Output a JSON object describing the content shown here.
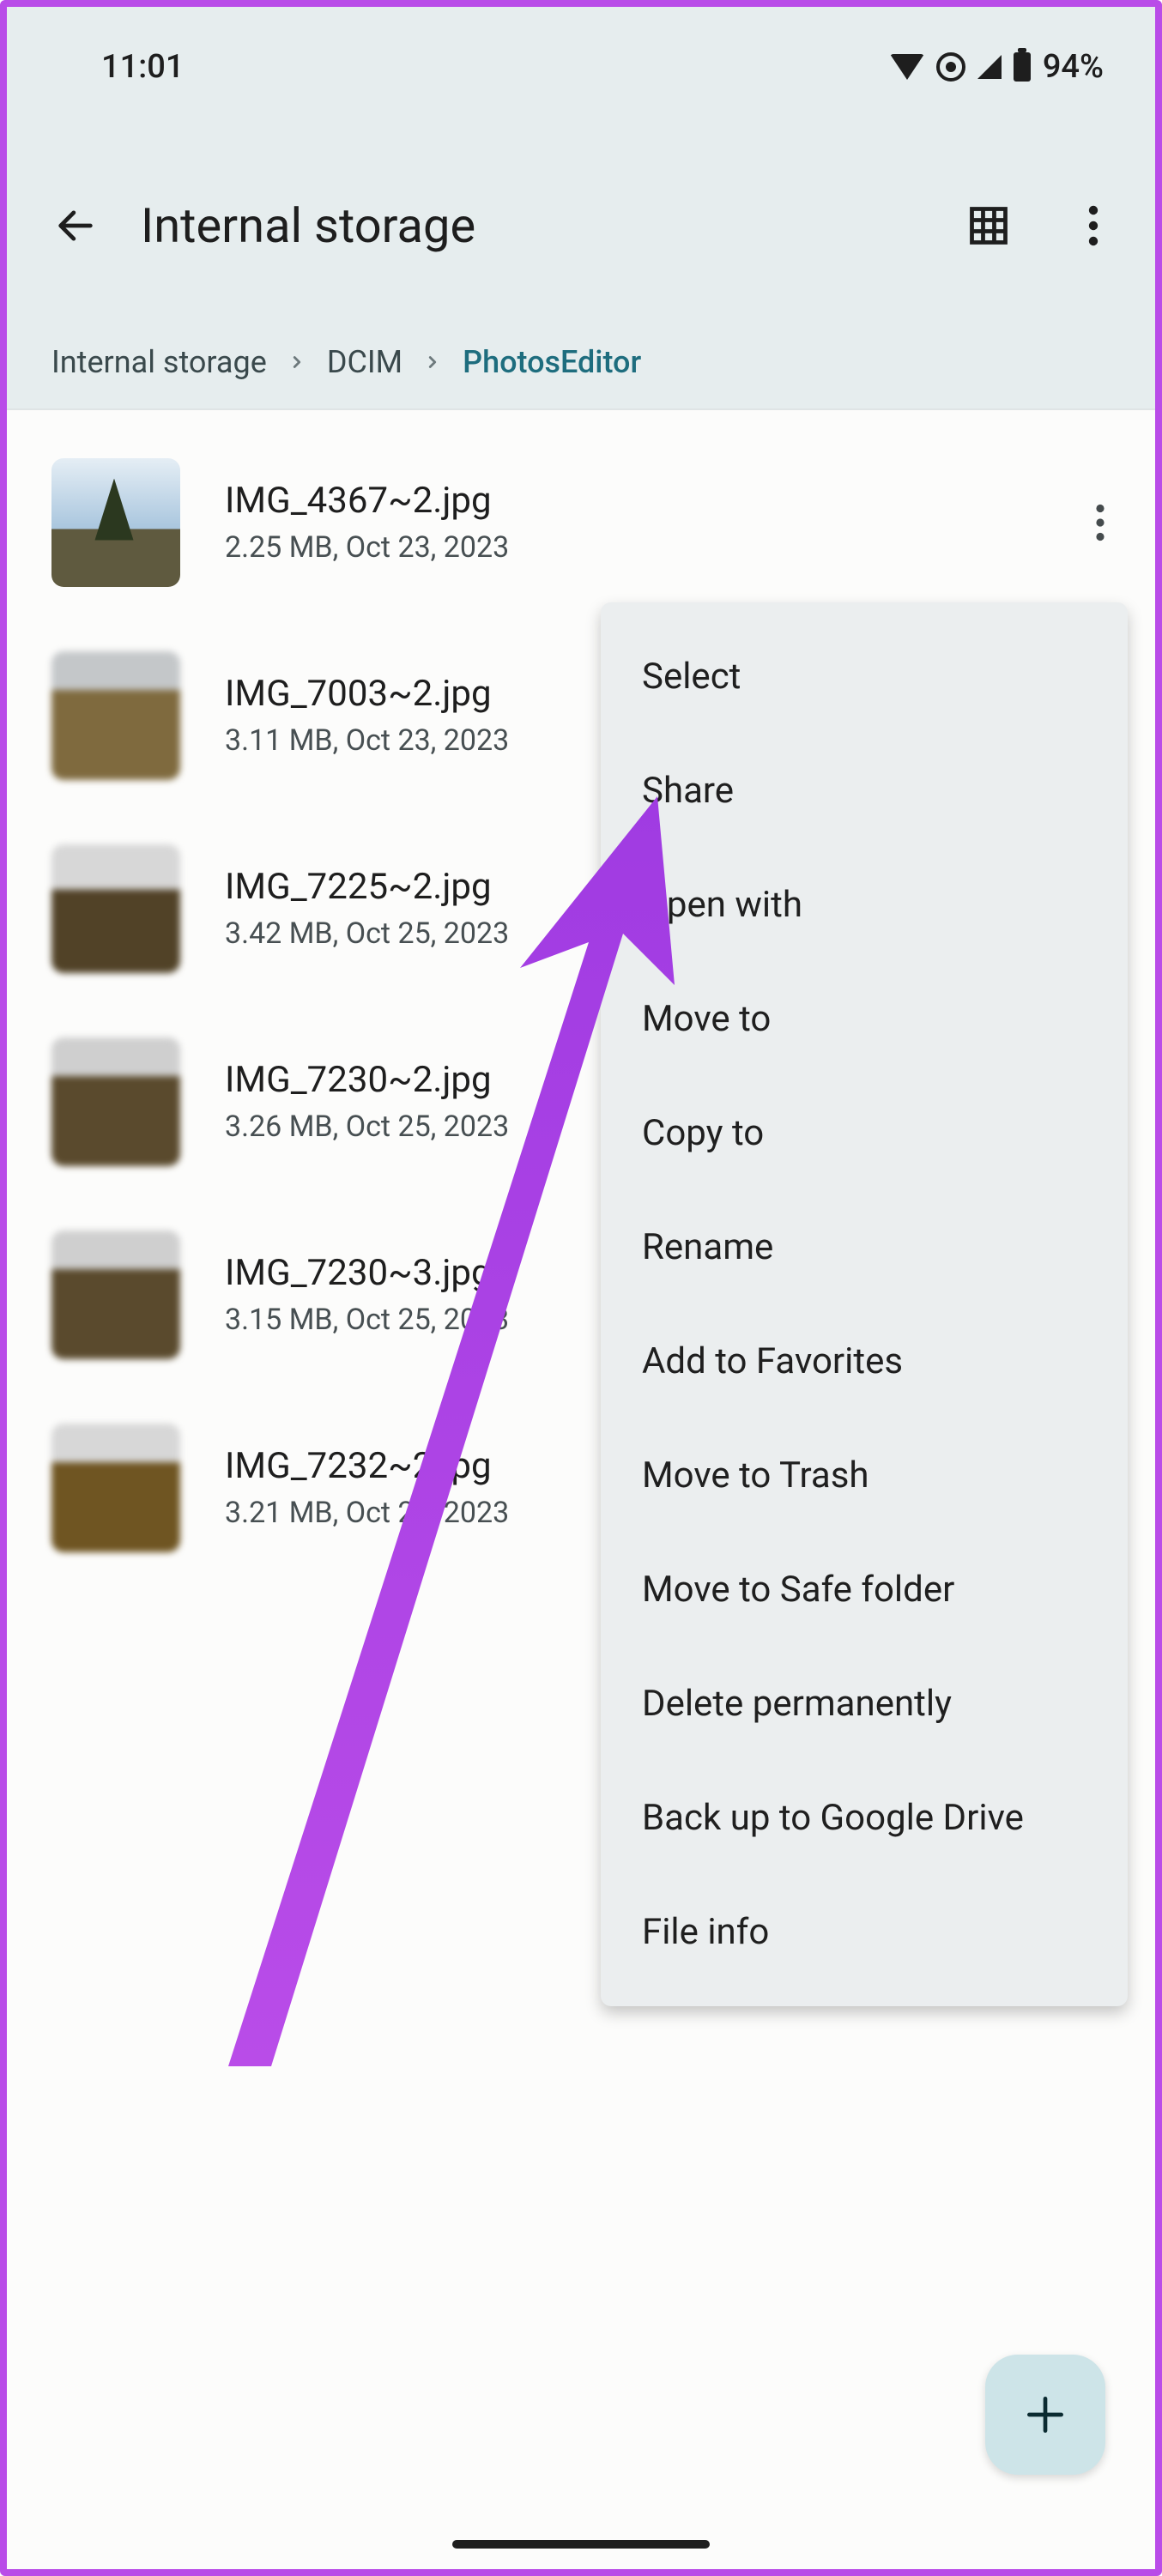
{
  "statusbar": {
    "time": "11:01",
    "battery_text": "94%"
  },
  "appbar": {
    "title": "Internal storage"
  },
  "breadcrumb": {
    "items": [
      "Internal storage",
      "DCIM",
      "PhotosEditor"
    ]
  },
  "files": [
    {
      "name": "IMG_4367~2.jpg",
      "meta": "2.25 MB, Oct 23, 2023"
    },
    {
      "name": "IMG_7003~2.jpg",
      "meta": "3.11 MB, Oct 23, 2023"
    },
    {
      "name": "IMG_7225~2.jpg",
      "meta": "3.42 MB, Oct 25, 2023"
    },
    {
      "name": "IMG_7230~2.jpg",
      "meta": "3.26 MB, Oct 25, 2023"
    },
    {
      "name": "IMG_7230~3.jpg",
      "meta": "3.15 MB, Oct 25, 2023"
    },
    {
      "name": "IMG_7232~2.jpg",
      "meta": "3.21 MB, Oct 25, 2023"
    }
  ],
  "menu": {
    "items": [
      "Select",
      "Share",
      "Open with",
      "Move to",
      "Copy to",
      "Rename",
      "Add to Favorites",
      "Move to Trash",
      "Move to Safe folder",
      "Delete permanently",
      "Back up to Google Drive",
      "File info"
    ]
  }
}
